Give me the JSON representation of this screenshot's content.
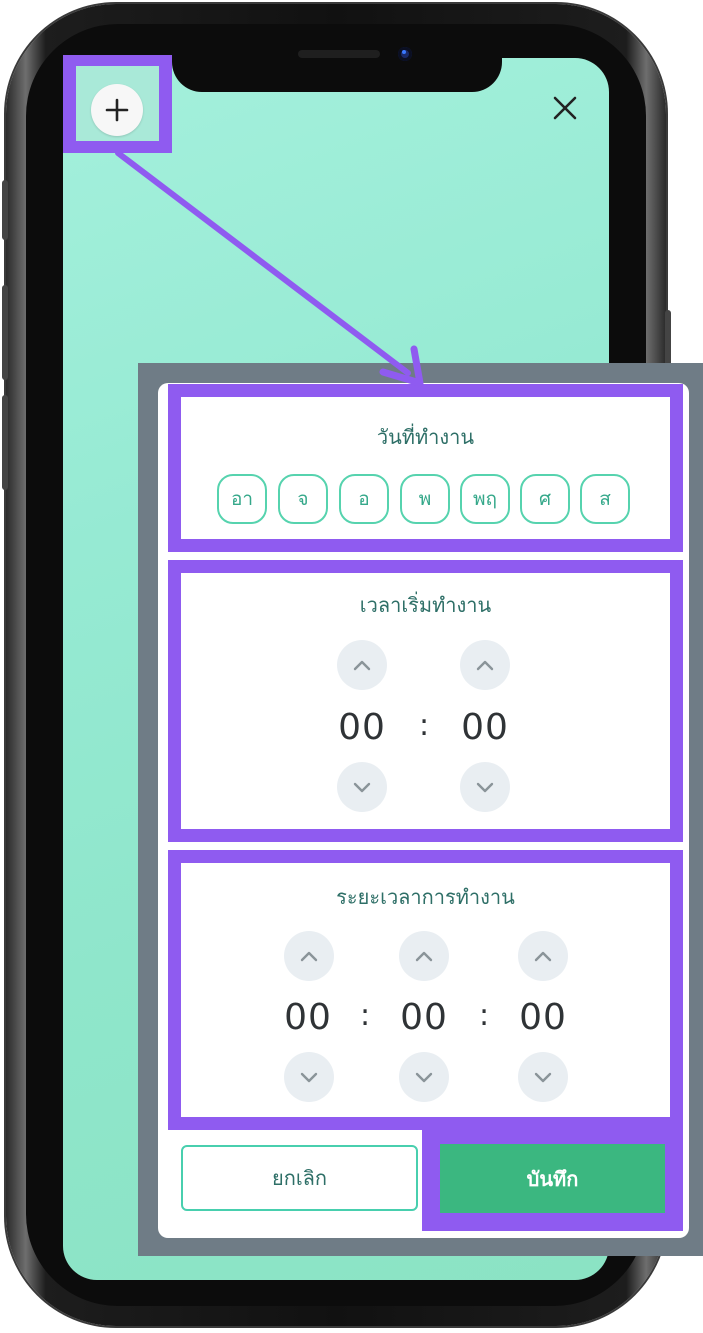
{
  "header": {
    "add_icon": "plus-icon",
    "close_icon": "close-icon"
  },
  "work_days": {
    "title": "วันที่ทำงาน",
    "days": [
      "อา",
      "จ",
      "อ",
      "พ",
      "พฤ",
      "ศ",
      "ส"
    ]
  },
  "start_time": {
    "title": "เวลาเริ่มทำงาน",
    "hour": "00",
    "minute": "00",
    "separator": ":"
  },
  "duration": {
    "title": "ระยะเวลาการทำงาน",
    "hours": "00",
    "minutes": "00",
    "seconds": "00",
    "separator": ":"
  },
  "actions": {
    "cancel_label": "ยกเลิก",
    "save_label": "บันทึก"
  },
  "colors": {
    "highlight": "#8f5bf0",
    "accent": "#3bb780",
    "day_border": "#56d3ae",
    "screen_bg": "#96ead3"
  }
}
